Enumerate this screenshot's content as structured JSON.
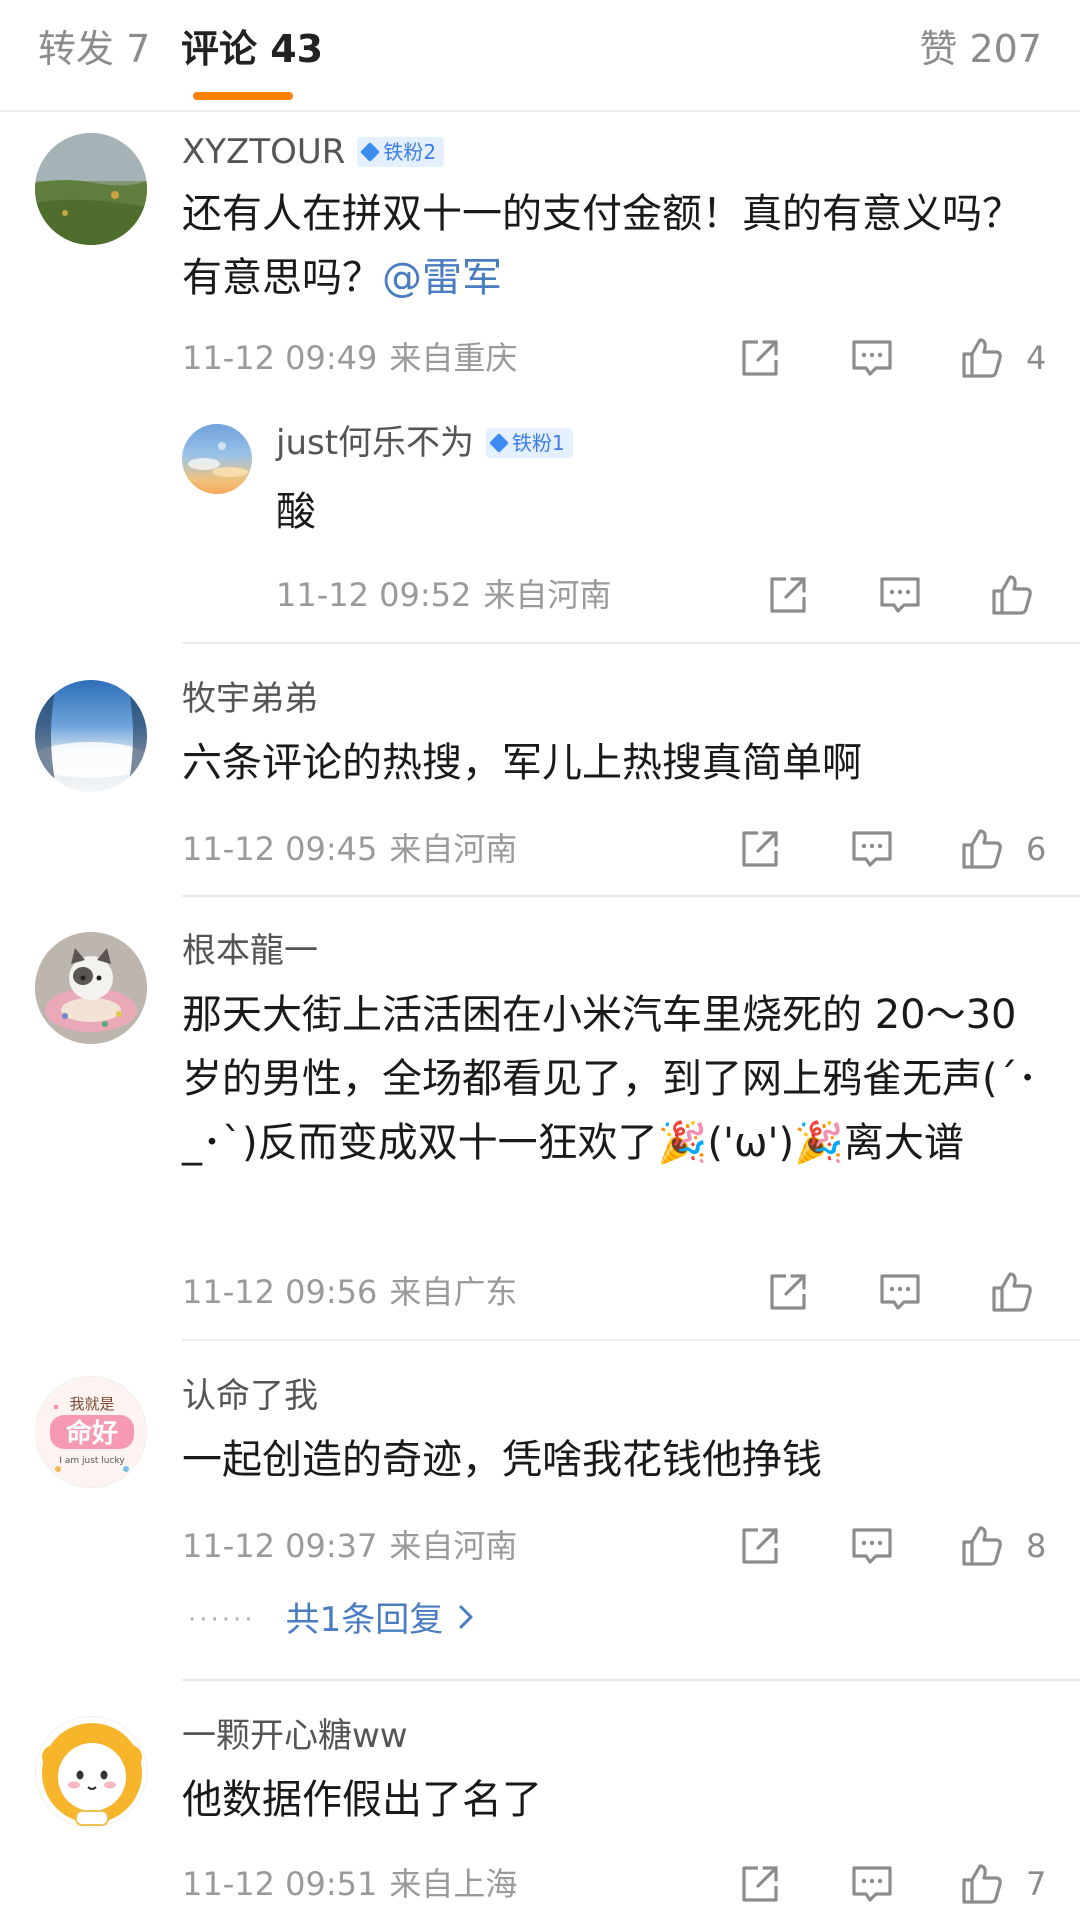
{
  "tabs": {
    "repost": "转发 7",
    "comments": "评论 43",
    "likes": "赞 207"
  },
  "comments": [
    {
      "username": "XYZTOUR",
      "badge": "铁粉2",
      "text_before_mention": "还有人在拼双十一的支付金额！真的有意义吗？有意思吗？",
      "mention": "@雷军",
      "time": "11-12 09:49",
      "location": "来自重庆",
      "likes": "4",
      "reply": {
        "username": "just何乐不为",
        "badge": "铁粉1",
        "text": "酸",
        "time": "11-12 09:52",
        "location": "来自河南"
      }
    },
    {
      "username": "牧宇弟弟",
      "text": "六条评论的热搜，军儿上热搜真简单啊",
      "time": "11-12 09:45",
      "location": "来自河南",
      "likes": "6"
    },
    {
      "username": "根本龍一",
      "text": "那天大街上活活困在小米汽车里烧死的 20～30 岁的男性，全场都看见了，到了网上鸦雀无声(´･_･`)反而变成双十一狂欢了🎉('ω')🎉离大谱",
      "time": "11-12 09:56",
      "location": "来自广东"
    },
    {
      "username": "认命了我",
      "text": "一起创造的奇迹，凭啥我花钱他挣钱",
      "time": "11-12 09:37",
      "location": "来自河南",
      "likes": "8",
      "more_replies": "共1条回复",
      "avatar_text_top": "我就是",
      "avatar_text_main": "命好",
      "avatar_text_sub": "I am just lucky"
    },
    {
      "username": "一颗开心糖ww",
      "text": "他数据作假出了名了",
      "time": "11-12 09:51",
      "location": "来自上海",
      "likes": "7"
    }
  ],
  "icons": {
    "share": "share-icon",
    "comment": "comment-icon",
    "like": "thumbs-up-icon"
  },
  "colors": {
    "accent": "#ff8200",
    "link": "#4a7cc2",
    "badge_bg": "#e4efff"
  }
}
